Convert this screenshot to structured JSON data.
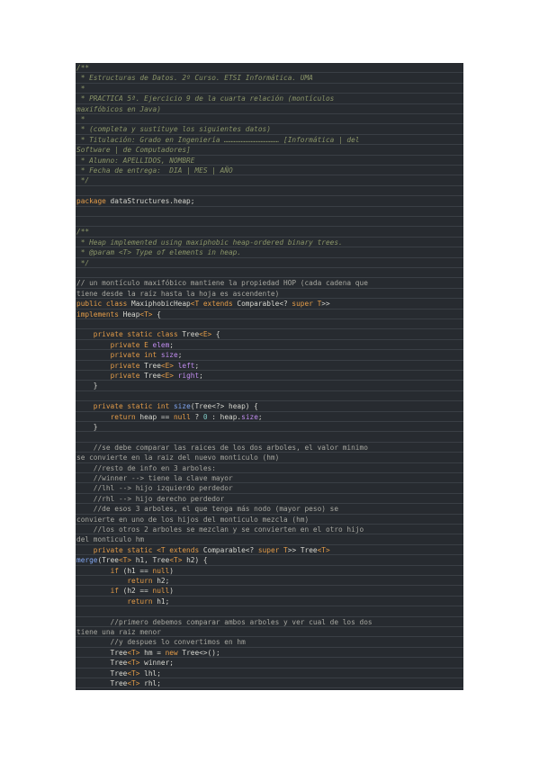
{
  "colors": {
    "panel_background": "#272b30",
    "comment": "#8a9468",
    "keyword": "#e49c48",
    "field": "#c28df0",
    "method": "#82a7f2",
    "plain": "#d7d7d0"
  },
  "code_lines": [
    {
      "kind": "text",
      "tokens": [
        [
          "comment",
          "/**"
        ]
      ]
    },
    {
      "kind": "text",
      "tokens": [
        [
          "comment",
          " * Estructuras de Datos. 2º Curso. ETSI Informática. UMA"
        ]
      ]
    },
    {
      "kind": "text",
      "tokens": [
        [
          "comment",
          " *"
        ]
      ]
    },
    {
      "kind": "text",
      "tokens": [
        [
          "comment",
          " * PRACTICA 5ª. Ejercicio 9 de la cuarta relación (montículos"
        ]
      ]
    },
    {
      "kind": "text",
      "tokens": [
        [
          "comment",
          "maxifóbicos en Java)"
        ]
      ]
    },
    {
      "kind": "text",
      "tokens": [
        [
          "comment",
          " *"
        ]
      ]
    },
    {
      "kind": "text",
      "tokens": [
        [
          "comment",
          " * (completa y sustituye los siguientes datos)"
        ]
      ]
    },
    {
      "kind": "text",
      "tokens": [
        [
          "comment",
          " * Titulación: Grado en Ingeniería ………………………………… [Informática | del"
        ]
      ]
    },
    {
      "kind": "text",
      "tokens": [
        [
          "comment",
          "Software | de Computadores]"
        ]
      ]
    },
    {
      "kind": "text",
      "tokens": [
        [
          "comment",
          " * Alumno: APELLIDOS, NOMBRE"
        ]
      ]
    },
    {
      "kind": "text",
      "tokens": [
        [
          "comment",
          " * Fecha de entrega:  DIA | MES | AÑO"
        ]
      ]
    },
    {
      "kind": "text",
      "tokens": [
        [
          "comment",
          " */"
        ]
      ]
    },
    {
      "kind": "blank",
      "tokens": []
    },
    {
      "kind": "text",
      "tokens": [
        [
          "keyword",
          "package"
        ],
        [
          "plain",
          " dataStructures.heap;"
        ]
      ]
    },
    {
      "kind": "blank",
      "tokens": []
    },
    {
      "kind": "blank",
      "tokens": []
    },
    {
      "kind": "text",
      "tokens": [
        [
          "comment",
          "/**"
        ]
      ]
    },
    {
      "kind": "text",
      "tokens": [
        [
          "comment",
          " * Heap implemented using maxiphobic heap-ordered binary trees."
        ]
      ]
    },
    {
      "kind": "text",
      "tokens": [
        [
          "comment",
          " * @param <T> Type of elements in heap."
        ]
      ]
    },
    {
      "kind": "text",
      "tokens": [
        [
          "comment",
          " */"
        ]
      ]
    },
    {
      "kind": "blank",
      "tokens": []
    },
    {
      "kind": "text",
      "tokens": [
        [
          "line-comment",
          "// un montículo maxifóbico mantiene la propiedad HOP (cada cadena que"
        ]
      ]
    },
    {
      "kind": "text",
      "tokens": [
        [
          "line-comment",
          "tiene desde la raíz hasta la hoja es ascendente)"
        ]
      ]
    },
    {
      "kind": "text",
      "tokens": [
        [
          "keyword",
          "public class "
        ],
        [
          "plain",
          "MaxiphobicHeap"
        ],
        [
          "generic",
          "<T extends "
        ],
        [
          "plain",
          "Comparable<? "
        ],
        [
          "keyword",
          "super "
        ],
        [
          "generic",
          "T"
        ],
        [
          "plain",
          ">>"
        ]
      ]
    },
    {
      "kind": "text",
      "tokens": [
        [
          "keyword",
          "implements "
        ],
        [
          "plain",
          "Heap"
        ],
        [
          "generic",
          "<T>"
        ],
        [
          "plain",
          " {"
        ]
      ]
    },
    {
      "kind": "blank",
      "tokens": []
    },
    {
      "kind": "text",
      "tokens": [
        [
          "plain",
          "    "
        ],
        [
          "keyword",
          "private static class "
        ],
        [
          "plain",
          "Tree"
        ],
        [
          "generic",
          "<E>"
        ],
        [
          "plain",
          " {"
        ]
      ]
    },
    {
      "kind": "text",
      "tokens": [
        [
          "plain",
          "        "
        ],
        [
          "keyword",
          "private "
        ],
        [
          "generic",
          "E "
        ],
        [
          "field",
          "elem"
        ],
        [
          "plain",
          ";"
        ]
      ]
    },
    {
      "kind": "text",
      "tokens": [
        [
          "plain",
          "        "
        ],
        [
          "keyword",
          "private int "
        ],
        [
          "field",
          "size"
        ],
        [
          "plain",
          ";"
        ]
      ]
    },
    {
      "kind": "text",
      "tokens": [
        [
          "plain",
          "        "
        ],
        [
          "keyword",
          "private "
        ],
        [
          "plain",
          "Tree"
        ],
        [
          "generic",
          "<E> "
        ],
        [
          "field",
          "left"
        ],
        [
          "plain",
          ";"
        ]
      ]
    },
    {
      "kind": "text",
      "tokens": [
        [
          "plain",
          "        "
        ],
        [
          "keyword",
          "private "
        ],
        [
          "plain",
          "Tree"
        ],
        [
          "generic",
          "<E> "
        ],
        [
          "field",
          "right"
        ],
        [
          "plain",
          ";"
        ]
      ]
    },
    {
      "kind": "text",
      "tokens": [
        [
          "plain",
          "    }"
        ]
      ]
    },
    {
      "kind": "blank",
      "tokens": []
    },
    {
      "kind": "text",
      "tokens": [
        [
          "plain",
          "    "
        ],
        [
          "keyword",
          "private static int "
        ],
        [
          "method",
          "size"
        ],
        [
          "plain",
          "(Tree<?> heap) {"
        ]
      ]
    },
    {
      "kind": "text",
      "tokens": [
        [
          "plain",
          "        "
        ],
        [
          "keyword",
          "return "
        ],
        [
          "plain",
          "heap == "
        ],
        [
          "keyword",
          "null "
        ],
        [
          "plain",
          "? "
        ],
        [
          "number",
          "0"
        ],
        [
          "plain",
          " : heap."
        ],
        [
          "field",
          "size"
        ],
        [
          "plain",
          ";"
        ]
      ]
    },
    {
      "kind": "text",
      "tokens": [
        [
          "plain",
          "    }"
        ]
      ]
    },
    {
      "kind": "blank",
      "tokens": []
    },
    {
      "kind": "text",
      "tokens": [
        [
          "line-comment",
          "    //se debe comparar las raices de los dos arboles, el valor minimo"
        ]
      ]
    },
    {
      "kind": "text",
      "tokens": [
        [
          "line-comment",
          "se convierte en la raiz del nuevo monticulo (hm)"
        ]
      ]
    },
    {
      "kind": "text",
      "tokens": [
        [
          "line-comment",
          "    //resto de info en 3 arboles:"
        ]
      ]
    },
    {
      "kind": "text",
      "tokens": [
        [
          "line-comment",
          "    //winner --> tiene la clave mayor"
        ]
      ]
    },
    {
      "kind": "text",
      "tokens": [
        [
          "line-comment",
          "    //lhl --> hijo izquierdo perdedor"
        ]
      ]
    },
    {
      "kind": "text",
      "tokens": [
        [
          "line-comment",
          "    //rhl --> hijo derecho perdedor"
        ]
      ]
    },
    {
      "kind": "text",
      "tokens": [
        [
          "line-comment",
          "    //de esos 3 arboles, el que tenga más nodo (mayor peso) se"
        ]
      ]
    },
    {
      "kind": "text",
      "tokens": [
        [
          "line-comment",
          "convierte en uno de los hijos del monticulo mezcla (hm)"
        ]
      ]
    },
    {
      "kind": "text",
      "tokens": [
        [
          "line-comment",
          "    //los otros 2 arboles se mezclan y se convierten en el otro hijo"
        ]
      ]
    },
    {
      "kind": "text",
      "tokens": [
        [
          "line-comment",
          "del monticulo hm"
        ]
      ]
    },
    {
      "kind": "text",
      "tokens": [
        [
          "plain",
          "    "
        ],
        [
          "keyword",
          "private static "
        ],
        [
          "generic",
          "<T extends "
        ],
        [
          "plain",
          "Comparable<? "
        ],
        [
          "keyword",
          "super "
        ],
        [
          "generic",
          "T"
        ],
        [
          "plain",
          ">> Tree"
        ],
        [
          "generic",
          "<T>"
        ]
      ]
    },
    {
      "kind": "text",
      "tokens": [
        [
          "method",
          "merge"
        ],
        [
          "plain",
          "(Tree"
        ],
        [
          "generic",
          "<T>"
        ],
        [
          "plain",
          " h1, Tree"
        ],
        [
          "generic",
          "<T>"
        ],
        [
          "plain",
          " h2) {"
        ]
      ]
    },
    {
      "kind": "text",
      "tokens": [
        [
          "plain",
          "        "
        ],
        [
          "keyword",
          "if "
        ],
        [
          "plain",
          "(h1 == "
        ],
        [
          "keyword",
          "null"
        ],
        [
          "plain",
          ")"
        ]
      ]
    },
    {
      "kind": "text",
      "tokens": [
        [
          "plain",
          "            "
        ],
        [
          "keyword",
          "return "
        ],
        [
          "plain",
          "h2;"
        ]
      ]
    },
    {
      "kind": "text",
      "tokens": [
        [
          "plain",
          "        "
        ],
        [
          "keyword",
          "if "
        ],
        [
          "plain",
          "(h2 == "
        ],
        [
          "keyword",
          "null"
        ],
        [
          "plain",
          ")"
        ]
      ]
    },
    {
      "kind": "text",
      "tokens": [
        [
          "plain",
          "            "
        ],
        [
          "keyword",
          "return "
        ],
        [
          "plain",
          "h1;"
        ]
      ]
    },
    {
      "kind": "blank",
      "tokens": []
    },
    {
      "kind": "text",
      "tokens": [
        [
          "line-comment",
          "        //primero debemos comparar ambos arboles y ver cual de los dos"
        ]
      ]
    },
    {
      "kind": "text",
      "tokens": [
        [
          "line-comment",
          "tiene una raiz menor"
        ]
      ]
    },
    {
      "kind": "text",
      "tokens": [
        [
          "line-comment",
          "        //y despues lo convertimos en hm"
        ]
      ]
    },
    {
      "kind": "text",
      "tokens": [
        [
          "plain",
          "        Tree"
        ],
        [
          "generic",
          "<T>"
        ],
        [
          "plain",
          " hm = "
        ],
        [
          "keyword",
          "new "
        ],
        [
          "plain",
          "Tree<>();"
        ]
      ]
    },
    {
      "kind": "text",
      "tokens": [
        [
          "plain",
          "        Tree"
        ],
        [
          "generic",
          "<T>"
        ],
        [
          "plain",
          " winner;"
        ]
      ]
    },
    {
      "kind": "text",
      "tokens": [
        [
          "plain",
          "        Tree"
        ],
        [
          "generic",
          "<T>"
        ],
        [
          "plain",
          " lhl;"
        ]
      ]
    },
    {
      "kind": "text",
      "tokens": [
        [
          "plain",
          "        Tree"
        ],
        [
          "generic",
          "<T>"
        ],
        [
          "plain",
          " rhl;"
        ]
      ]
    }
  ]
}
